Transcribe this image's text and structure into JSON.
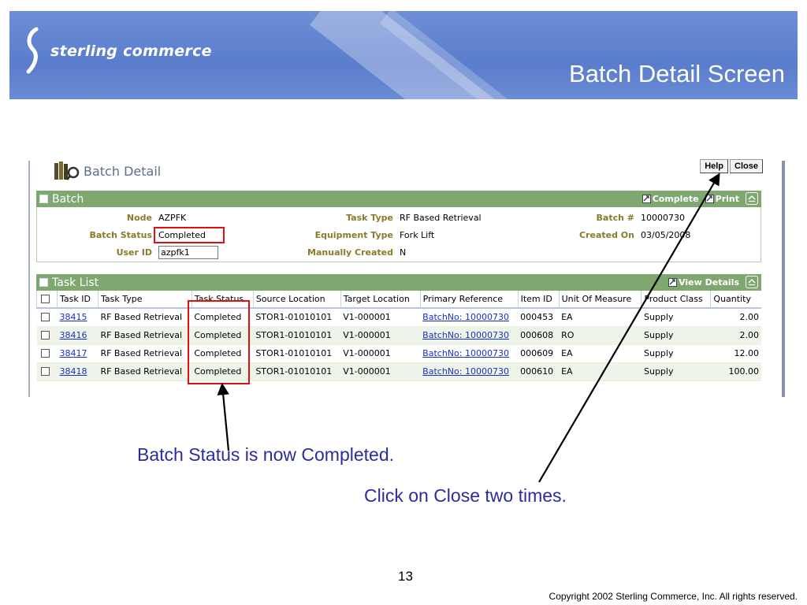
{
  "slide": {
    "logo_text": "sterling commerce",
    "title": "Batch Detail Screen",
    "page_number": "13",
    "copyright": "Copyright 2002 Sterling Commerce, Inc. All rights reserved.",
    "notes": [
      "Batch Status is now Completed.",
      "Click on Close two times."
    ]
  },
  "screen": {
    "title": "Batch Detail",
    "buttons": {
      "help": "Help",
      "close": "Close"
    },
    "batch_panel": {
      "title": "Batch",
      "actions": {
        "complete": "Complete",
        "print": "Print"
      },
      "fields": {
        "node": {
          "label": "Node",
          "value": "AZPFK"
        },
        "batch_status": {
          "label": "Batch Status",
          "value": "Completed"
        },
        "user_id": {
          "label": "User ID",
          "value": "azpfk1"
        },
        "task_type": {
          "label": "Task Type",
          "value": "RF Based Retrieval"
        },
        "equipment_type": {
          "label": "Equipment Type",
          "value": "Fork Lift"
        },
        "manually_created": {
          "label": "Manually Created",
          "value": "N"
        },
        "batch_no": {
          "label": "Batch #",
          "value": "10000730"
        },
        "created_on": {
          "label": "Created On",
          "value": "03/05/2008"
        }
      }
    },
    "task_panel": {
      "title": "Task List",
      "actions": {
        "view_details": "View Details"
      },
      "columns": [
        "Task ID",
        "Task Type",
        "Task Status",
        "Source Location",
        "Target Location",
        "Primary Reference",
        "Item ID",
        "Unit Of Measure",
        "Product Class",
        "Quantity"
      ],
      "rows": [
        {
          "task_id": "38415",
          "task_type": "RF Based Retrieval",
          "status": "Completed",
          "source": "STOR1-01010101",
          "target": "V1-000001",
          "reference": "BatchNo: 10000730",
          "item_id": "000453",
          "uom": "EA",
          "product_class": "Supply",
          "quantity": "2.00"
        },
        {
          "task_id": "38416",
          "task_type": "RF Based Retrieval",
          "status": "Completed",
          "source": "STOR1-01010101",
          "target": "V1-000001",
          "reference": "BatchNo: 10000730",
          "item_id": "000608",
          "uom": "RO",
          "product_class": "Supply",
          "quantity": "2.00"
        },
        {
          "task_id": "38417",
          "task_type": "RF Based Retrieval",
          "status": "Completed",
          "source": "STOR1-01010101",
          "target": "V1-000001",
          "reference": "BatchNo: 10000730",
          "item_id": "000609",
          "uom": "EA",
          "product_class": "Supply",
          "quantity": "12.00"
        },
        {
          "task_id": "38418",
          "task_type": "RF Based Retrieval",
          "status": "Completed",
          "source": "STOR1-01010101",
          "target": "V1-000001",
          "reference": "BatchNo: 10000730",
          "item_id": "000610",
          "uom": "EA",
          "product_class": "Supply",
          "quantity": "100.00"
        }
      ]
    }
  },
  "colors": {
    "banner": "#5a7dcc",
    "panel_header": "#7fa870",
    "field_label": "#8a7a2a",
    "link": "#1a2fc7",
    "annotation_red": "#e01010",
    "note_text": "#2c2ca0"
  }
}
